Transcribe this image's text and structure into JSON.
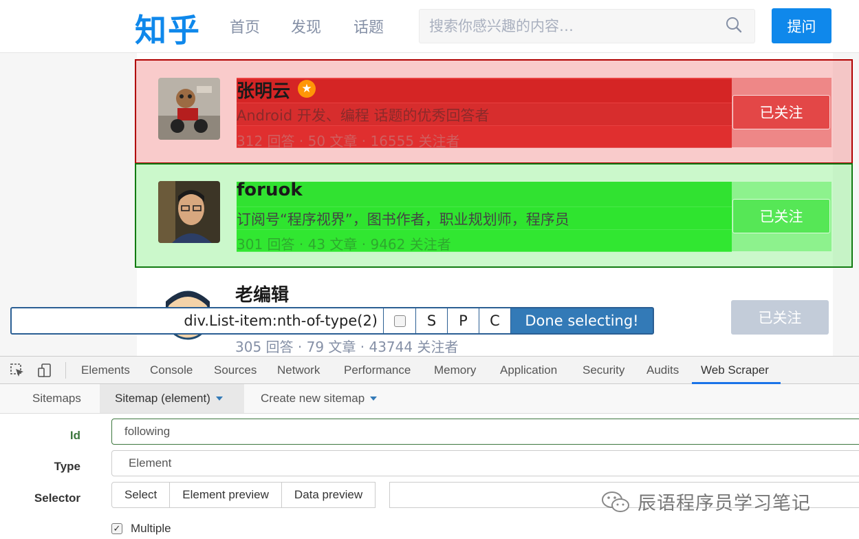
{
  "header": {
    "logo": "知乎",
    "nav": [
      "首页",
      "发现",
      "话题"
    ],
    "search_placeholder": "搜索你感兴趣的内容…",
    "ask_label": "提问"
  },
  "list": [
    {
      "name": "张明云",
      "bio": "Android 开发、编程 话题的优秀回答者",
      "stats": "312 回答 · 50 文章 · 16555 关注者",
      "follow": "已关注"
    },
    {
      "name": "foruok",
      "bio": "订阅号“程序视界”，图书作者，职业规划师，程序员",
      "stats": "301 回答 · 43 文章 · 9462 关注者",
      "follow": "已关注"
    },
    {
      "name": "老编辑",
      "stats": "305 回答 · 79 文章 · 43744 关注者",
      "follow": "已关注"
    }
  ],
  "selector_bar": {
    "value": "div.List-item:nth-of-type(2)",
    "keys": [
      "S",
      "P",
      "C"
    ],
    "done_label": "Done selecting!"
  },
  "devtools": {
    "tabs": [
      "Elements",
      "Console",
      "Sources",
      "Network",
      "Performance",
      "Memory",
      "Application",
      "Security",
      "Audits",
      "Web Scraper"
    ],
    "active_tab": "Web Scraper"
  },
  "scraper": {
    "nav": [
      "Sitemaps",
      "Sitemap (element)",
      "Create new sitemap"
    ],
    "form": {
      "id_label": "Id",
      "id_value": "following",
      "type_label": "Type",
      "type_value": "Element",
      "selector_label": "Selector",
      "buttons": [
        "Select",
        "Element preview",
        "Data preview"
      ],
      "multiple_label": "Multiple"
    }
  },
  "watermark": "辰语程序员学习笔记",
  "colors": {
    "brand": "#0f88eb",
    "selected_highlight": "#e03030",
    "hover_highlight": "#3ce03c",
    "done_button": "#337ab7"
  }
}
